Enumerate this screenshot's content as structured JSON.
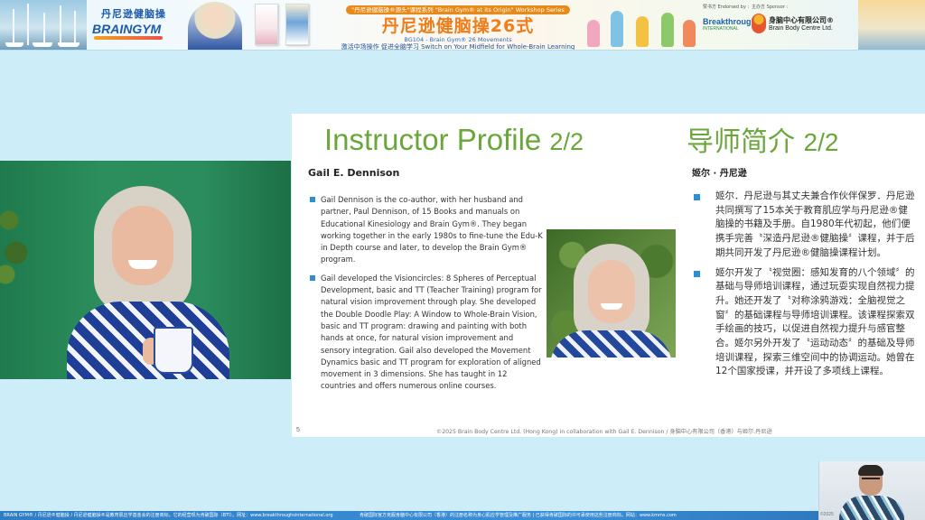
{
  "banner": {
    "logo_cn": "丹尼逊健脑操",
    "logo_en": "BRAINGYM",
    "series": "\"丹尼逊健脑操®源头\"课程系列 \"Brain Gym® at its Origin\" Workshop Series",
    "title": "丹尼逊健脑操26式",
    "subcode": "BG104 - Brain Gym® 26 Movements",
    "tagline": "激活中场操作 促进全脑学习 Switch on Your Midfield for Whole-Brain Learning",
    "endorsed_label": "赞书方 Endorsed by :",
    "endorser": "Breakthroughs",
    "endorser_sub": "INTERNATIONAL",
    "sponsor_label": "主办方 Sponsor :",
    "sponsor_cn": "身脑中心有限公司®",
    "sponsor_en": "Brain Body Centre Ltd."
  },
  "slide": {
    "title_en": "Instructor Profile",
    "title_en_num": "2/2",
    "title_cn": "导师简介",
    "title_cn_num": "2/2",
    "name_en": "Gail E. Dennison",
    "name_cn": "姬尔 · 丹尼逊",
    "bullets_en": [
      "Gail Dennison is the co-author, with her husband and partner, Paul Dennison, of 15 Books and manuals on Educational Kinesiology and Brain Gym®. They began working together in the early 1980s to fine-tune the Edu-K in Depth course and later, to develop the Brain Gym® program.",
      "Gail developed the Visioncircles: 8 Spheres of Perceptual Development, basic and TT (Teacher Training) program for natural vision improvement through play. She developed the Double Doodle Play: A Window to Whole-Brain Vision, basic and TT program: drawing and painting with both hands at once, for natural vision improvement and sensory integration. Gail also developed the Movement Dynamics basic and TT program for exploration of aligned movement in 3 dimensions. She has taught in 12 countries and offers numerous online courses."
    ],
    "bullets_cn": [
      "姬尔．丹尼逊与其丈夫兼合作伙伴保罗．丹尼逊共同撰写了15本关于教育肌应学与丹尼逊®健脑操的书籍及手册。自1980年代初起，他们便携手完善〝深造丹尼逊®健脑操〞课程，并于后期共同开发了丹尼逊®健脑操课程计划。",
      "姬尔开发了〝视觉圈：感知发育的八个领域〞的基础与导师培训课程，通过玩耍实现自然视力提升。她还开发了〝对称涂鸦游戏：全脑视觉之窗〞的基础课程与导师培训课程。该课程探索双手绘画的技巧，以促进自然视力提升与感官整合。姬尔另外开发了〝运动动态〞的基础及导师培训课程，探索三维空间中的协调运动。她曾在12个国家授课，并开设了多项线上课程。"
    ],
    "page_number": "5",
    "footer": "©2025 Brain Body Centre Ltd. (Hong Kong) in collaboration with Gail E. Dennison / 身脑中心有限公司（香港）与姬尔.丹尼逊"
  },
  "bottom_bar": {
    "left": "BRAIN GYM® / 丹尼逊®健脑操 / 丹尼逊健脑操®是教育肌应学基金会的注册商标，它的经营现为肯破国际（BTI）。网址：www.breakthroughsinternational.org",
    "right": "肯破国际官方克服身脑中心有限公司（香港）的注册名称为身心肌应学管理及推广服务 | 已获得肯破国际的许可承使用这些注册商标。网站：www.kmms.com"
  },
  "presenter_cam": {
    "stamp": "©2025"
  },
  "colors": {
    "title_green": "#6aa63a",
    "bullet_blue": "#2b8fd2",
    "banner_orange": "#ef7d1a",
    "background": "#cdeef9"
  }
}
